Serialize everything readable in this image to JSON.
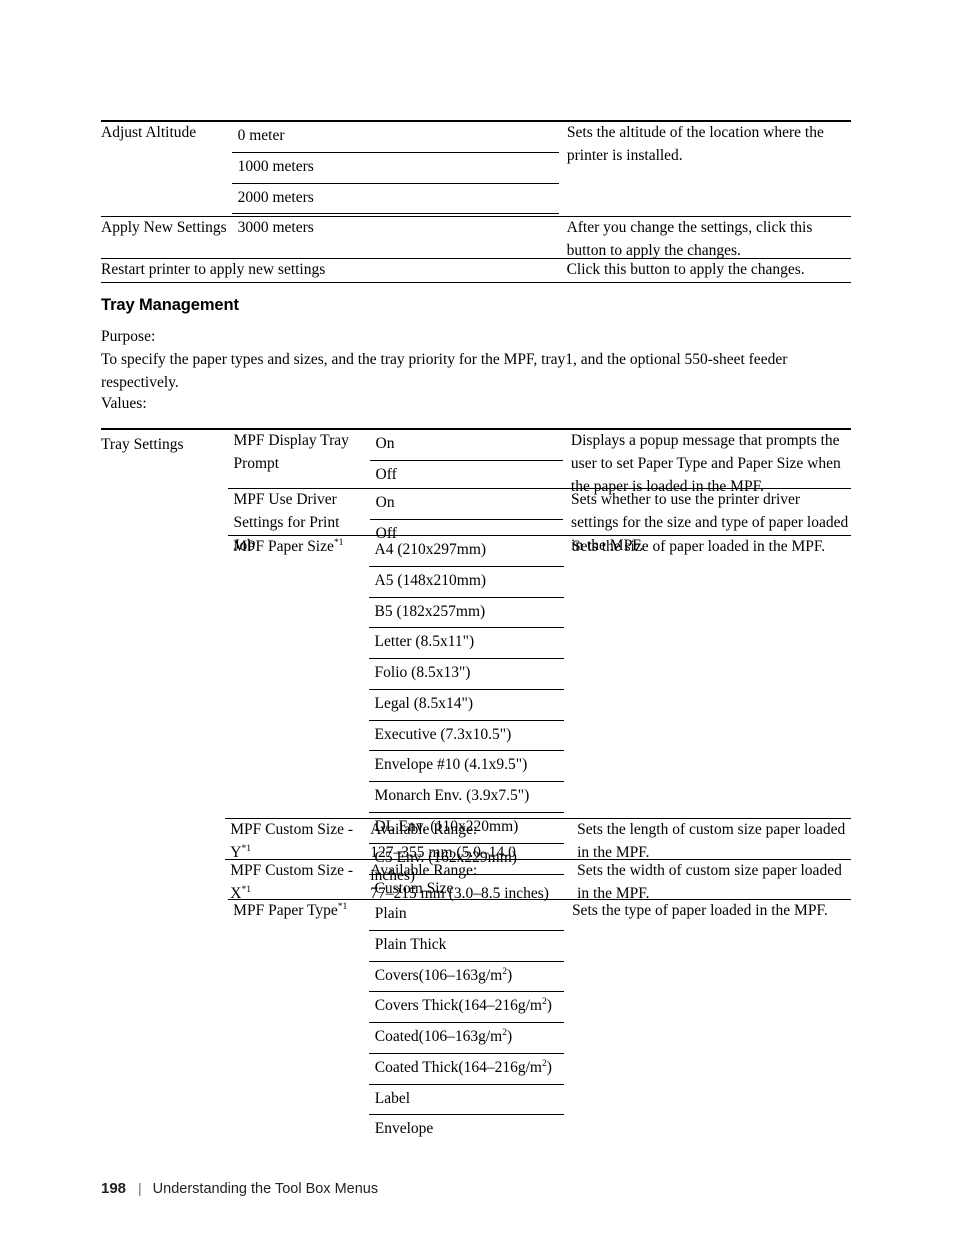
{
  "document": {
    "footer": {
      "page_number": "198",
      "separator": "|",
      "section_title": "Understanding the Tool Box Menus"
    }
  },
  "table_top": {
    "rows": [
      {
        "name": "Adjust Altitude",
        "options": [
          "0 meter",
          "1000 meters",
          "2000 meters",
          "3000 meters"
        ],
        "description": "Sets the altitude of the location where the printer is installed."
      },
      {
        "name": "Apply New Settings",
        "options": [],
        "description": "After you change the settings, click this button to apply the changes."
      },
      {
        "name": "Restart printer to apply new settings",
        "options": [],
        "description": "Click this button to apply the changes."
      }
    ]
  },
  "section": {
    "heading": "Tray Management",
    "purpose_label": "Purpose:",
    "purpose_text": "To specify the paper types and sizes, and the tray priority for the MPF, tray1, and the optional 550-sheet feeder respectively.",
    "values_label": "Values:"
  },
  "table_tray": {
    "group_name": "Tray Settings",
    "rows": [
      {
        "sub_name": "MPF Display Tray Prompt",
        "sub_name_sup": "",
        "options": [
          "On",
          "Off"
        ],
        "description": "Displays a popup message that prompts the user to set Paper Type and Paper Size when the paper is loaded in the MPF."
      },
      {
        "sub_name": "MPF Use Driver Settings for Print Job",
        "sub_name_sup": "",
        "options": [
          "On",
          "Off"
        ],
        "description": "Sets whether to use the printer driver settings for the size and type of paper loaded in the MPF."
      },
      {
        "sub_name": "MPF Paper Size",
        "sub_name_sup": "*1",
        "options": [
          "A4 (210x297mm)",
          "A5 (148x210mm)",
          "B5 (182x257mm)",
          "Letter (8.5x11\")",
          "Folio (8.5x13\")",
          "Legal (8.5x14\")",
          "Executive (7.3x10.5\")",
          "Envelope #10 (4.1x9.5\")",
          "Monarch Env. (3.9x7.5\")",
          "DL Env. (110x220mm)",
          "C5 Env. (162x229mm)",
          "Custom Size"
        ],
        "description": "Sets the size of paper loaded in the MPF."
      },
      {
        "sub_name": "MPF Custom Size - Y",
        "sub_name_sup": "*1",
        "options": [
          "Available Range: 127–355 mm (5.0–14.0 inches)"
        ],
        "description": "Sets the length of custom size paper loaded in the MPF."
      },
      {
        "sub_name": "MPF Custom Size - X",
        "sub_name_sup": "*1",
        "options": [
          "Available Range: 77–215 mm (3.0–8.5 inches)"
        ],
        "description": "Sets the width of custom size paper loaded in the MPF."
      },
      {
        "sub_name": "MPF Paper Type",
        "sub_name_sup": "*1",
        "options": [
          "Plain",
          "Plain Thick",
          "Covers(106–163g/m2)",
          "Covers Thick(164–216g/m2)",
          "Coated(106–163g/m2)",
          "Coated Thick(164–216g/m2)",
          "Label",
          "Envelope"
        ],
        "description": "Sets the type of paper loaded in the MPF."
      }
    ]
  }
}
